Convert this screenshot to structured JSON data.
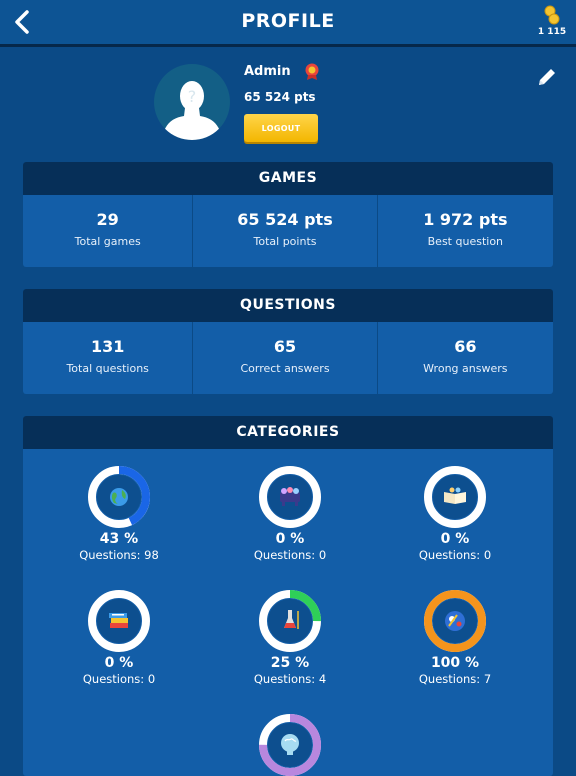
{
  "header": {
    "title": "PROFILE",
    "coins": "1 115",
    "back_icon": "back-arrow-icon",
    "coin_icon": "coins-icon"
  },
  "profile": {
    "name": "Admin",
    "points": "65 524 pts",
    "logout_label": "LOGOUT",
    "edit_icon": "pencil-icon",
    "badge_icon": "medal-icon"
  },
  "games": {
    "title": "GAMES",
    "stats": [
      {
        "value": "29",
        "label": "Total games"
      },
      {
        "value": "65 524 pts",
        "label": "Total points"
      },
      {
        "value": "1 972 pts",
        "label": "Best question"
      }
    ]
  },
  "questions": {
    "title": "QUESTIONS",
    "stats": [
      {
        "value": "131",
        "label": "Total questions"
      },
      {
        "value": "65",
        "label": "Correct answers"
      },
      {
        "value": "66",
        "label": "Wrong answers"
      }
    ]
  },
  "categories": {
    "title": "CATEGORIES",
    "items": [
      {
        "percent_label": "43 %",
        "questions_label": "Questions: 98",
        "progress": 0.43,
        "ring_color": "#1a66e6",
        "icon": "globe-icon"
      },
      {
        "percent_label": "0 %",
        "questions_label": "Questions: 0",
        "progress": 0,
        "ring_color": "#1a66e6",
        "icon": "music-band-icon"
      },
      {
        "percent_label": "0 %",
        "questions_label": "Questions: 0",
        "progress": 0,
        "ring_color": "#1a66e6",
        "icon": "open-book-icon"
      },
      {
        "percent_label": "0 %",
        "questions_label": "Questions: 0",
        "progress": 0,
        "ring_color": "#1a66e6",
        "icon": "books-icon"
      },
      {
        "percent_label": "25 %",
        "questions_label": "Questions: 4",
        "progress": 0.25,
        "ring_color": "#2fcf58",
        "icon": "chemistry-flask-icon"
      },
      {
        "percent_label": "100 %",
        "questions_label": "Questions: 7",
        "progress": 1,
        "ring_color": "#f4941c",
        "icon": "sports-icon"
      },
      {
        "percent_label": "",
        "questions_label": "",
        "progress": 0.75,
        "ring_color": "#b887de",
        "icon": "brain-icon"
      }
    ]
  }
}
